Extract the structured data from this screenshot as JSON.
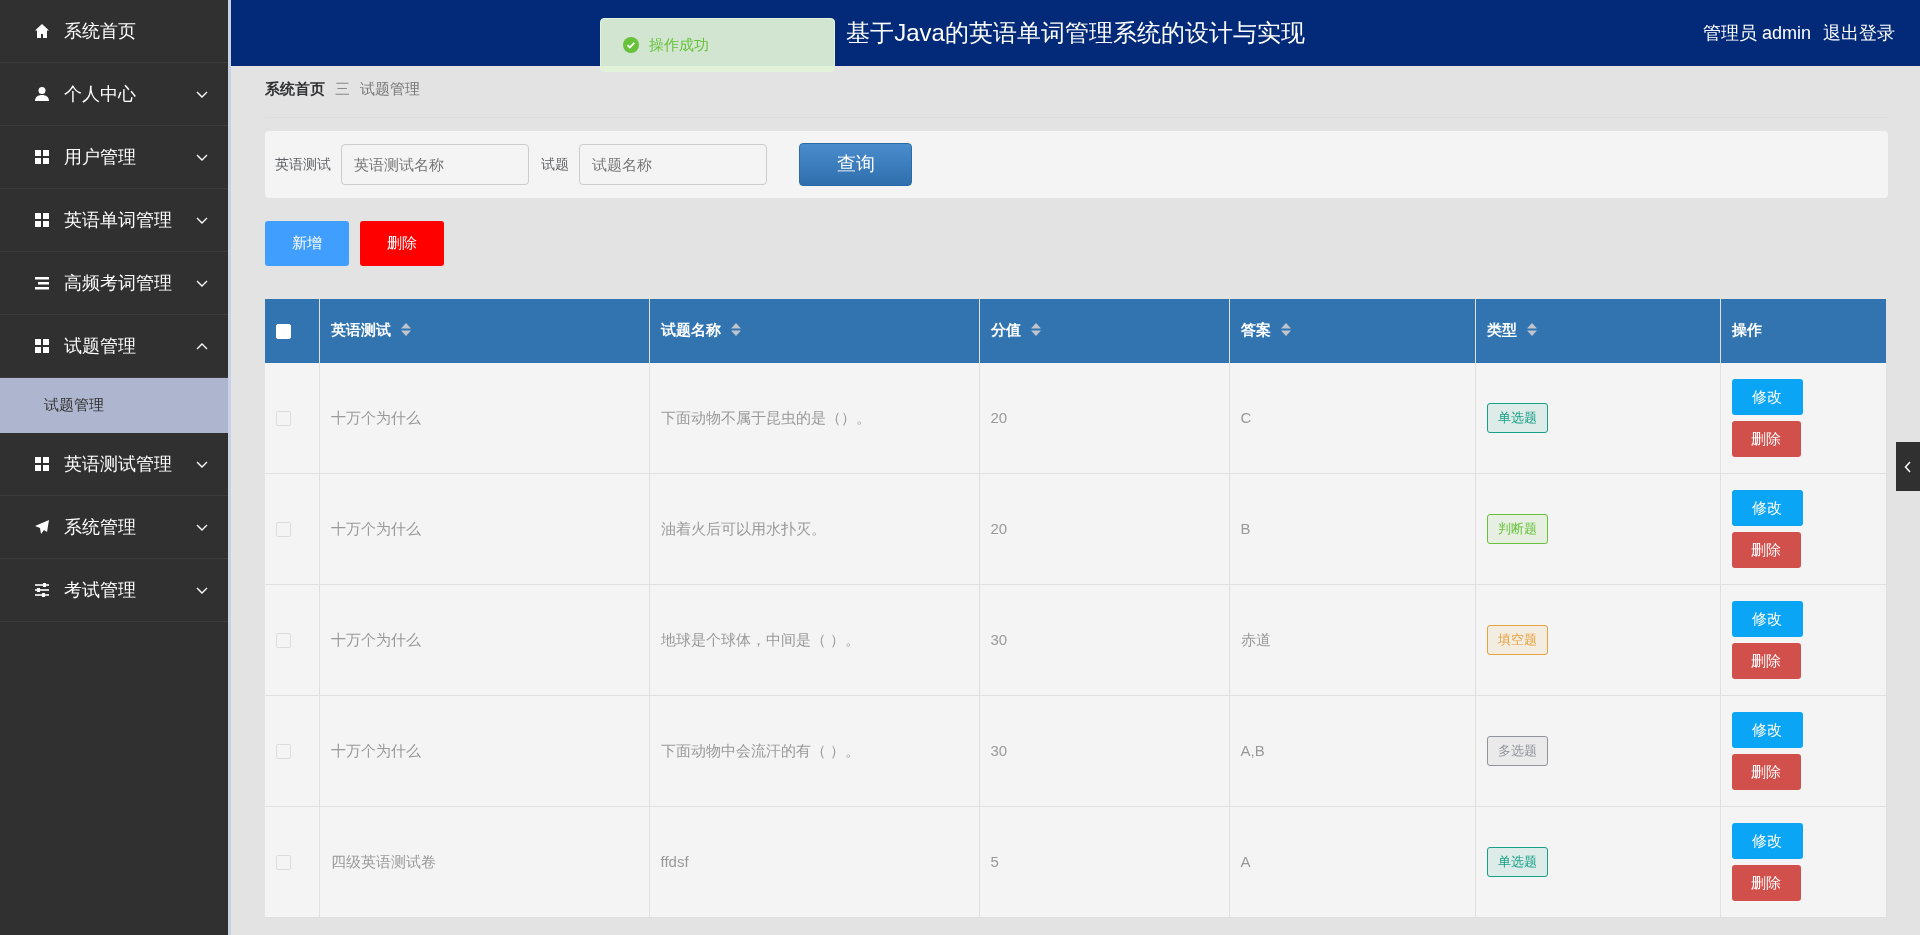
{
  "header": {
    "title": "基于Java的英语单词管理系统的设计与实现",
    "user": "管理员 admin",
    "logout": "退出登录"
  },
  "toast": {
    "text": "操作成功"
  },
  "sidebar": {
    "items": [
      {
        "label": "系统首页"
      },
      {
        "label": "个人中心",
        "expanded": false
      },
      {
        "label": "用户管理",
        "expanded": false
      },
      {
        "label": "英语单词管理",
        "expanded": false
      },
      {
        "label": "高频考词管理",
        "expanded": false
      },
      {
        "label": "试题管理",
        "expanded": true,
        "children": [
          {
            "label": "试题管理",
            "selected": true
          }
        ]
      },
      {
        "label": "英语测试管理",
        "expanded": false
      },
      {
        "label": "系统管理",
        "expanded": false
      },
      {
        "label": "考试管理",
        "expanded": false
      }
    ]
  },
  "breadcrumb": [
    "系统首页",
    "试题管理"
  ],
  "breadcrumb_separator": "三",
  "search": {
    "fields": [
      {
        "label": "英语测试",
        "placeholder": "英语测试名称"
      },
      {
        "label": "试题",
        "placeholder": "试题名称"
      }
    ],
    "button": "查询"
  },
  "actions": {
    "add": "新增",
    "delete": "删除"
  },
  "table": {
    "select_all_checked": false,
    "columns": [
      {
        "label": "英语测试",
        "sortable": true
      },
      {
        "label": "试题名称",
        "sortable": true
      },
      {
        "label": "分值",
        "sortable": true
      },
      {
        "label": "答案",
        "sortable": true
      },
      {
        "label": "类型",
        "sortable": true
      },
      {
        "label": "操作",
        "sortable": false
      }
    ],
    "rows": [
      {
        "checked": false,
        "test": "十万个为什么",
        "question": "下面动物不属于昆虫的是（）。",
        "score": "20",
        "answer": "C",
        "type": "单选题",
        "color": "#16a085",
        "edit": "修改",
        "delete": "删除"
      },
      {
        "checked": false,
        "test": "十万个为什么",
        "question": "油着火后可以用水扑灭。",
        "score": "20",
        "answer": "B",
        "type": "判断题",
        "color": "#67c23a",
        "edit": "修改",
        "delete": "删除"
      },
      {
        "checked": false,
        "test": "十万个为什么",
        "question": "地球是个球体，中间是（ ）。",
        "score": "30",
        "answer": "赤道",
        "type": "填空题",
        "color": "#e6a23c",
        "edit": "修改",
        "delete": "删除"
      },
      {
        "checked": false,
        "test": "十万个为什么",
        "question": "下面动物中会流汗的有（ ）。",
        "score": "30",
        "answer": "A,B",
        "type": "多选题",
        "color": "#909399",
        "edit": "修改",
        "delete": "删除"
      },
      {
        "checked": false,
        "test": "四级英语测试卷",
        "question": "ffdsf",
        "score": "5",
        "answer": "A",
        "type": "单选题",
        "color": "#16a085",
        "edit": "修改",
        "delete": "删除"
      }
    ]
  }
}
